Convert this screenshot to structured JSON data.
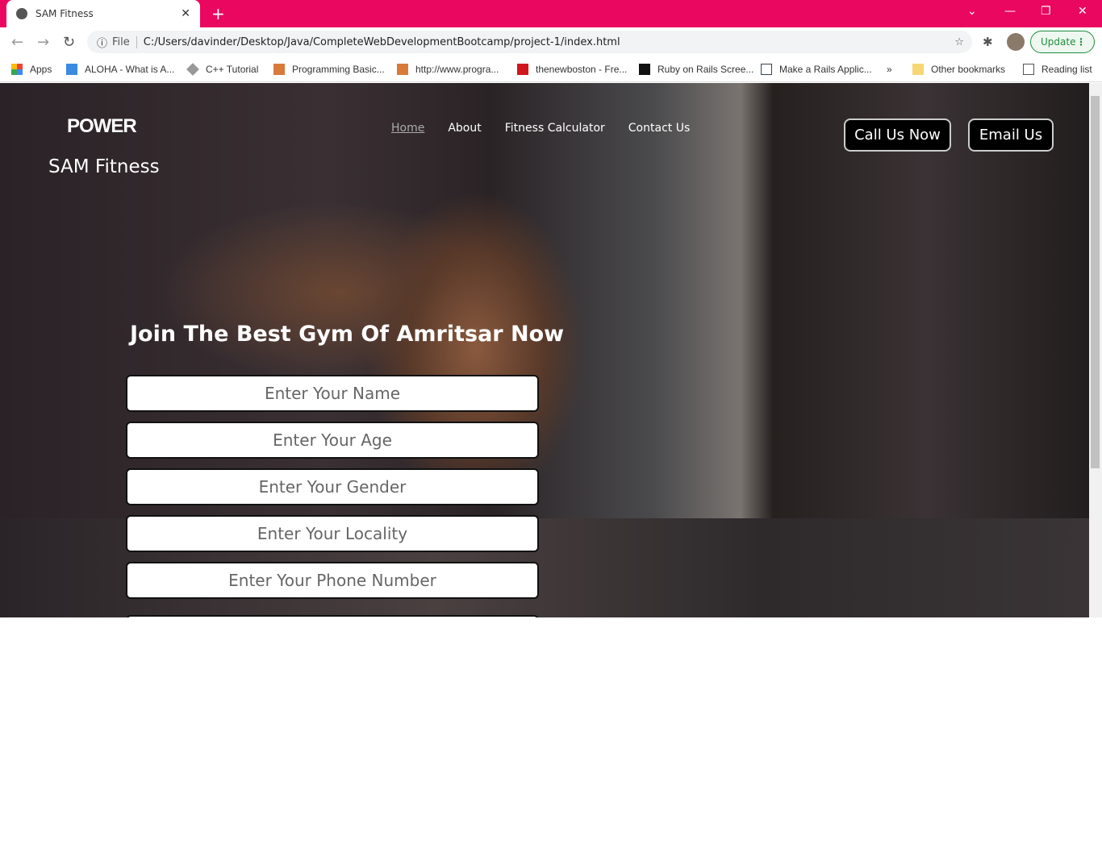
{
  "browser": {
    "tab_title": "SAM Fitness",
    "url_scheme": "File",
    "url": "C:/Users/davinder/Desktop/Java/CompleteWebDevelopmentBootcamp/project-1/index.html",
    "update_label": "Update",
    "bookmarks": [
      "Apps",
      "ALOHA - What is A...",
      "C++ Tutorial",
      "Programming Basic...",
      "http://www.progra...",
      "thenewboston - Fre...",
      "Ruby on Rails Scree...",
      "Make a Rails Applic..."
    ],
    "more": "»",
    "other_bookmarks": "Other bookmarks",
    "reading_list": "Reading list"
  },
  "site": {
    "logo": "POWER",
    "brand": "SAM Fitness",
    "nav": [
      "Home",
      "About",
      "Fitness Calculator",
      "Contact Us"
    ],
    "call_label": "Call Us Now",
    "email_label": "Email Us",
    "headline": "Join The Best Gym Of Amritsar Now",
    "form": {
      "name_placeholder": "Enter Your Name",
      "age_placeholder": "Enter Your Age",
      "gender_placeholder": "Enter Your Gender",
      "locality_placeholder": "Enter Your Locality",
      "phone_placeholder": "Enter Your Phone Number"
    }
  },
  "colors": {
    "tabbar": "#ea0760",
    "button_bg": "#000000"
  }
}
